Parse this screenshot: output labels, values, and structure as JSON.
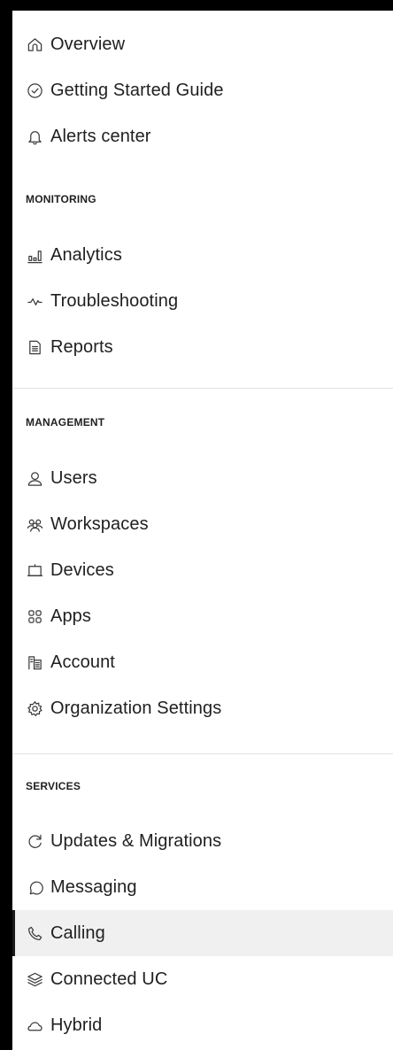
{
  "nav": {
    "top_items": [
      {
        "label": "Overview",
        "icon": "home-icon"
      },
      {
        "label": "Getting Started Guide",
        "icon": "check-circle-icon"
      },
      {
        "label": "Alerts center",
        "icon": "bell-icon"
      }
    ],
    "monitoring": {
      "title": "MONITORING",
      "items": [
        {
          "label": "Analytics",
          "icon": "bar-chart-icon"
        },
        {
          "label": "Troubleshooting",
          "icon": "pulse-icon"
        },
        {
          "label": "Reports",
          "icon": "document-icon"
        }
      ]
    },
    "management": {
      "title": "MANAGEMENT",
      "items": [
        {
          "label": "Users",
          "icon": "user-icon"
        },
        {
          "label": "Workspaces",
          "icon": "people-group-icon"
        },
        {
          "label": "Devices",
          "icon": "device-icon"
        },
        {
          "label": "Apps",
          "icon": "apps-grid-icon"
        },
        {
          "label": "Account",
          "icon": "account-building-icon"
        },
        {
          "label": "Organization Settings",
          "icon": "gear-icon"
        }
      ]
    },
    "services": {
      "title": "SERVICES",
      "items": [
        {
          "label": "Updates & Migrations",
          "icon": "refresh-icon"
        },
        {
          "label": "Messaging",
          "icon": "chat-bubble-icon"
        },
        {
          "label": "Calling",
          "icon": "phone-icon",
          "active": true
        },
        {
          "label": "Connected UC",
          "icon": "layers-icon"
        },
        {
          "label": "Hybrid",
          "icon": "cloud-icon"
        }
      ]
    }
  },
  "colors": {
    "active_background": "#f0f0f0",
    "active_indicator": "#1a1a1a",
    "divider": "#e3e3e3",
    "text": "#1f1f1f"
  }
}
